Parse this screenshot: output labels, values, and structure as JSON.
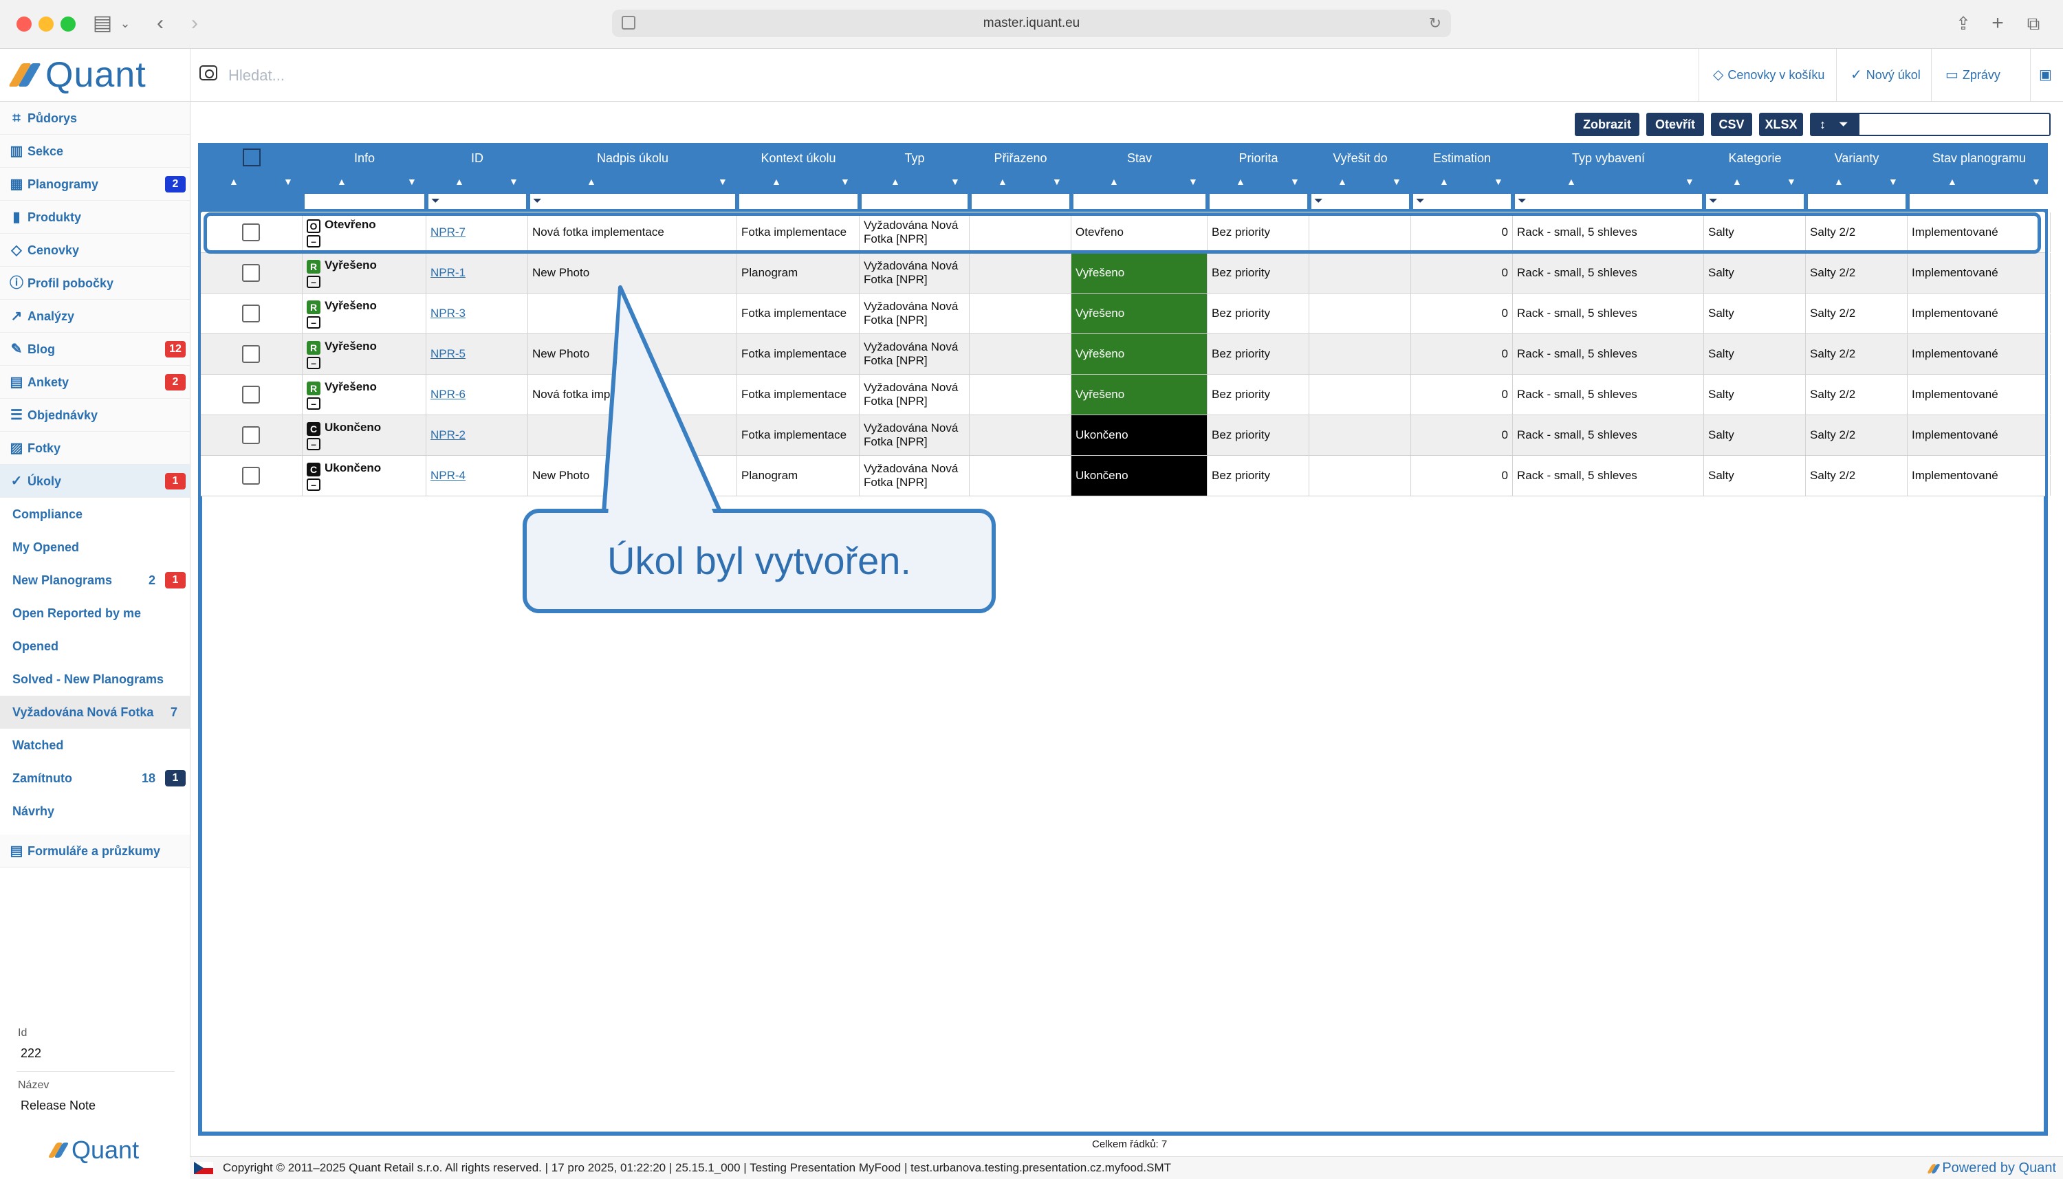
{
  "browser": {
    "url": "master.iquant.eu"
  },
  "app": {
    "logo_text": "Quant",
    "search_placeholder": "Hledat...",
    "header_buttons": {
      "cart": "Cenovky v košíku",
      "new_task": "Nový úkol",
      "messages": "Zprávy"
    }
  },
  "sidebar": {
    "items": [
      {
        "label": "Půdorys",
        "badge": ""
      },
      {
        "label": "Sekce",
        "badge": ""
      },
      {
        "label": "Planogramy",
        "badge": "2"
      },
      {
        "label": "Produkty",
        "badge": ""
      },
      {
        "label": "Cenovky",
        "badge": ""
      },
      {
        "label": "Profil pobočky",
        "badge": ""
      },
      {
        "label": "Analýzy",
        "badge": ""
      },
      {
        "label": "Blog",
        "badge": "12"
      },
      {
        "label": "Ankety",
        "badge": "2"
      },
      {
        "label": "Objednávky",
        "badge": ""
      },
      {
        "label": "Fotky",
        "badge": ""
      },
      {
        "label": "Úkoly",
        "badge": "1"
      }
    ],
    "sub_items": [
      {
        "label": "Compliance",
        "count": "",
        "badge": ""
      },
      {
        "label": "My Opened",
        "count": "",
        "badge": ""
      },
      {
        "label": "New Planograms",
        "count": "2",
        "badge": "1"
      },
      {
        "label": "Open Reported by me",
        "count": "",
        "badge": ""
      },
      {
        "label": "Opened",
        "count": "",
        "badge": ""
      },
      {
        "label": "Solved - New Planograms",
        "count": "",
        "badge": ""
      },
      {
        "label": "Vyžadována Nová Fotka",
        "count": "7",
        "badge": ""
      },
      {
        "label": "Watched",
        "count": "",
        "badge": ""
      },
      {
        "label": "Zamítnuto",
        "count": "18",
        "badge": "1"
      },
      {
        "label": "Návrhy",
        "count": "",
        "badge": ""
      }
    ],
    "forms_label": "Formuláře a průzkumy",
    "info": {
      "id_label": "Id",
      "id_value": "222",
      "name_label": "Název",
      "name_value": "Release Note"
    },
    "bottom_logo": "Quant"
  },
  "toolbar": {
    "show": "Zobrazit",
    "open": "Otevřít",
    "csv": "CSV",
    "xlsx": "XLSX",
    "sort_glyph": "↕",
    "filter_value": ""
  },
  "table": {
    "columns": [
      "",
      "Info",
      "ID",
      "Nadpis úkolu",
      "Kontext úkolu",
      "Typ",
      "Přiřazeno",
      "Stav",
      "Priorita",
      "Vyřešit do",
      "Estimation",
      "Typ vybavení",
      "Kategorie",
      "Varianty",
      "Stav planogramu"
    ],
    "rows": [
      {
        "status_letter": "O",
        "status": "Otevřeno",
        "id": "NPR-7",
        "title": "Nová fotka implementace",
        "context": "Fotka implementace",
        "type": "Vyžadována Nová Fotka [NPR]",
        "assigned": "",
        "state": "Otevřeno",
        "priority": "Bez priority",
        "due": "",
        "estimation": "0",
        "equipment": "Rack - small, 5 shleves",
        "category": "Salty",
        "variants": "Salty 2/2",
        "planogram_state": "Implementované"
      },
      {
        "status_letter": "R",
        "status": "Vyřešeno",
        "id": "NPR-1",
        "title": "New Photo",
        "context": "Planogram",
        "type": "Vyžadována Nová Fotka [NPR]",
        "assigned": "",
        "state": "Vyřešeno",
        "priority": "Bez priority",
        "due": "",
        "estimation": "0",
        "equipment": "Rack - small, 5 shleves",
        "category": "Salty",
        "variants": "Salty 2/2",
        "planogram_state": "Implementované"
      },
      {
        "status_letter": "R",
        "status": "Vyřešeno",
        "id": "NPR-3",
        "title": "",
        "context": "Fotka implementace",
        "type": "Vyžadována Nová Fotka [NPR]",
        "assigned": "",
        "state": "Vyřešeno",
        "priority": "Bez priority",
        "due": "",
        "estimation": "0",
        "equipment": "Rack - small, 5 shleves",
        "category": "Salty",
        "variants": "Salty 2/2",
        "planogram_state": "Implementované"
      },
      {
        "status_letter": "R",
        "status": "Vyřešeno",
        "id": "NPR-5",
        "title": "New Photo",
        "context": "Fotka implementace",
        "type": "Vyžadována Nová Fotka [NPR]",
        "assigned": "",
        "state": "Vyřešeno",
        "priority": "Bez priority",
        "due": "",
        "estimation": "0",
        "equipment": "Rack - small, 5 shleves",
        "category": "Salty",
        "variants": "Salty 2/2",
        "planogram_state": "Implementované"
      },
      {
        "status_letter": "R",
        "status": "Vyřešeno",
        "id": "NPR-6",
        "title": "Nová fotka impl",
        "context": "Fotka implementace",
        "type": "Vyžadována Nová Fotka [NPR]",
        "assigned": "",
        "state": "Vyřešeno",
        "priority": "Bez priority",
        "due": "",
        "estimation": "0",
        "equipment": "Rack - small, 5 shleves",
        "category": "Salty",
        "variants": "Salty 2/2",
        "planogram_state": "Implementované"
      },
      {
        "status_letter": "C",
        "status": "Ukončeno",
        "id": "NPR-2",
        "title": "",
        "context": "Fotka implementace",
        "type": "Vyžadována Nová Fotka [NPR]",
        "assigned": "",
        "state": "Ukončeno",
        "priority": "Bez priority",
        "due": "",
        "estimation": "0",
        "equipment": "Rack - small, 5 shleves",
        "category": "Salty",
        "variants": "Salty 2/2",
        "planogram_state": "Implementované"
      },
      {
        "status_letter": "C",
        "status": "Ukončeno",
        "id": "NPR-4",
        "title": "New Photo",
        "context": "Planogram",
        "type": "Vyžadována Nová Fotka [NPR]",
        "assigned": "",
        "state": "Ukončeno",
        "priority": "Bez priority",
        "due": "",
        "estimation": "0",
        "equipment": "Rack - small, 5 shleves",
        "category": "Salty",
        "variants": "Salty 2/2",
        "planogram_state": "Implementované"
      }
    ],
    "total_rows": "Celkem řádků: 7"
  },
  "callout": {
    "text": "Úkol byl vytvořen."
  },
  "footer": {
    "copyright": "Copyright © 2011–2025 Quant Retail s.r.o. All rights reserved. | 17 pro 2025, 01:22:20 | 25.15.1_000 | Testing Presentation MyFood | test.urbanova.testing.presentation.cz.myfood.SMT",
    "powered": "Powered by Quant"
  },
  "colors": {
    "accent": "#3a7fc1",
    "navy": "#1f3b63",
    "solved_green": "#2f7d24",
    "closed_black": "#000000",
    "badge_red": "#e53935"
  }
}
